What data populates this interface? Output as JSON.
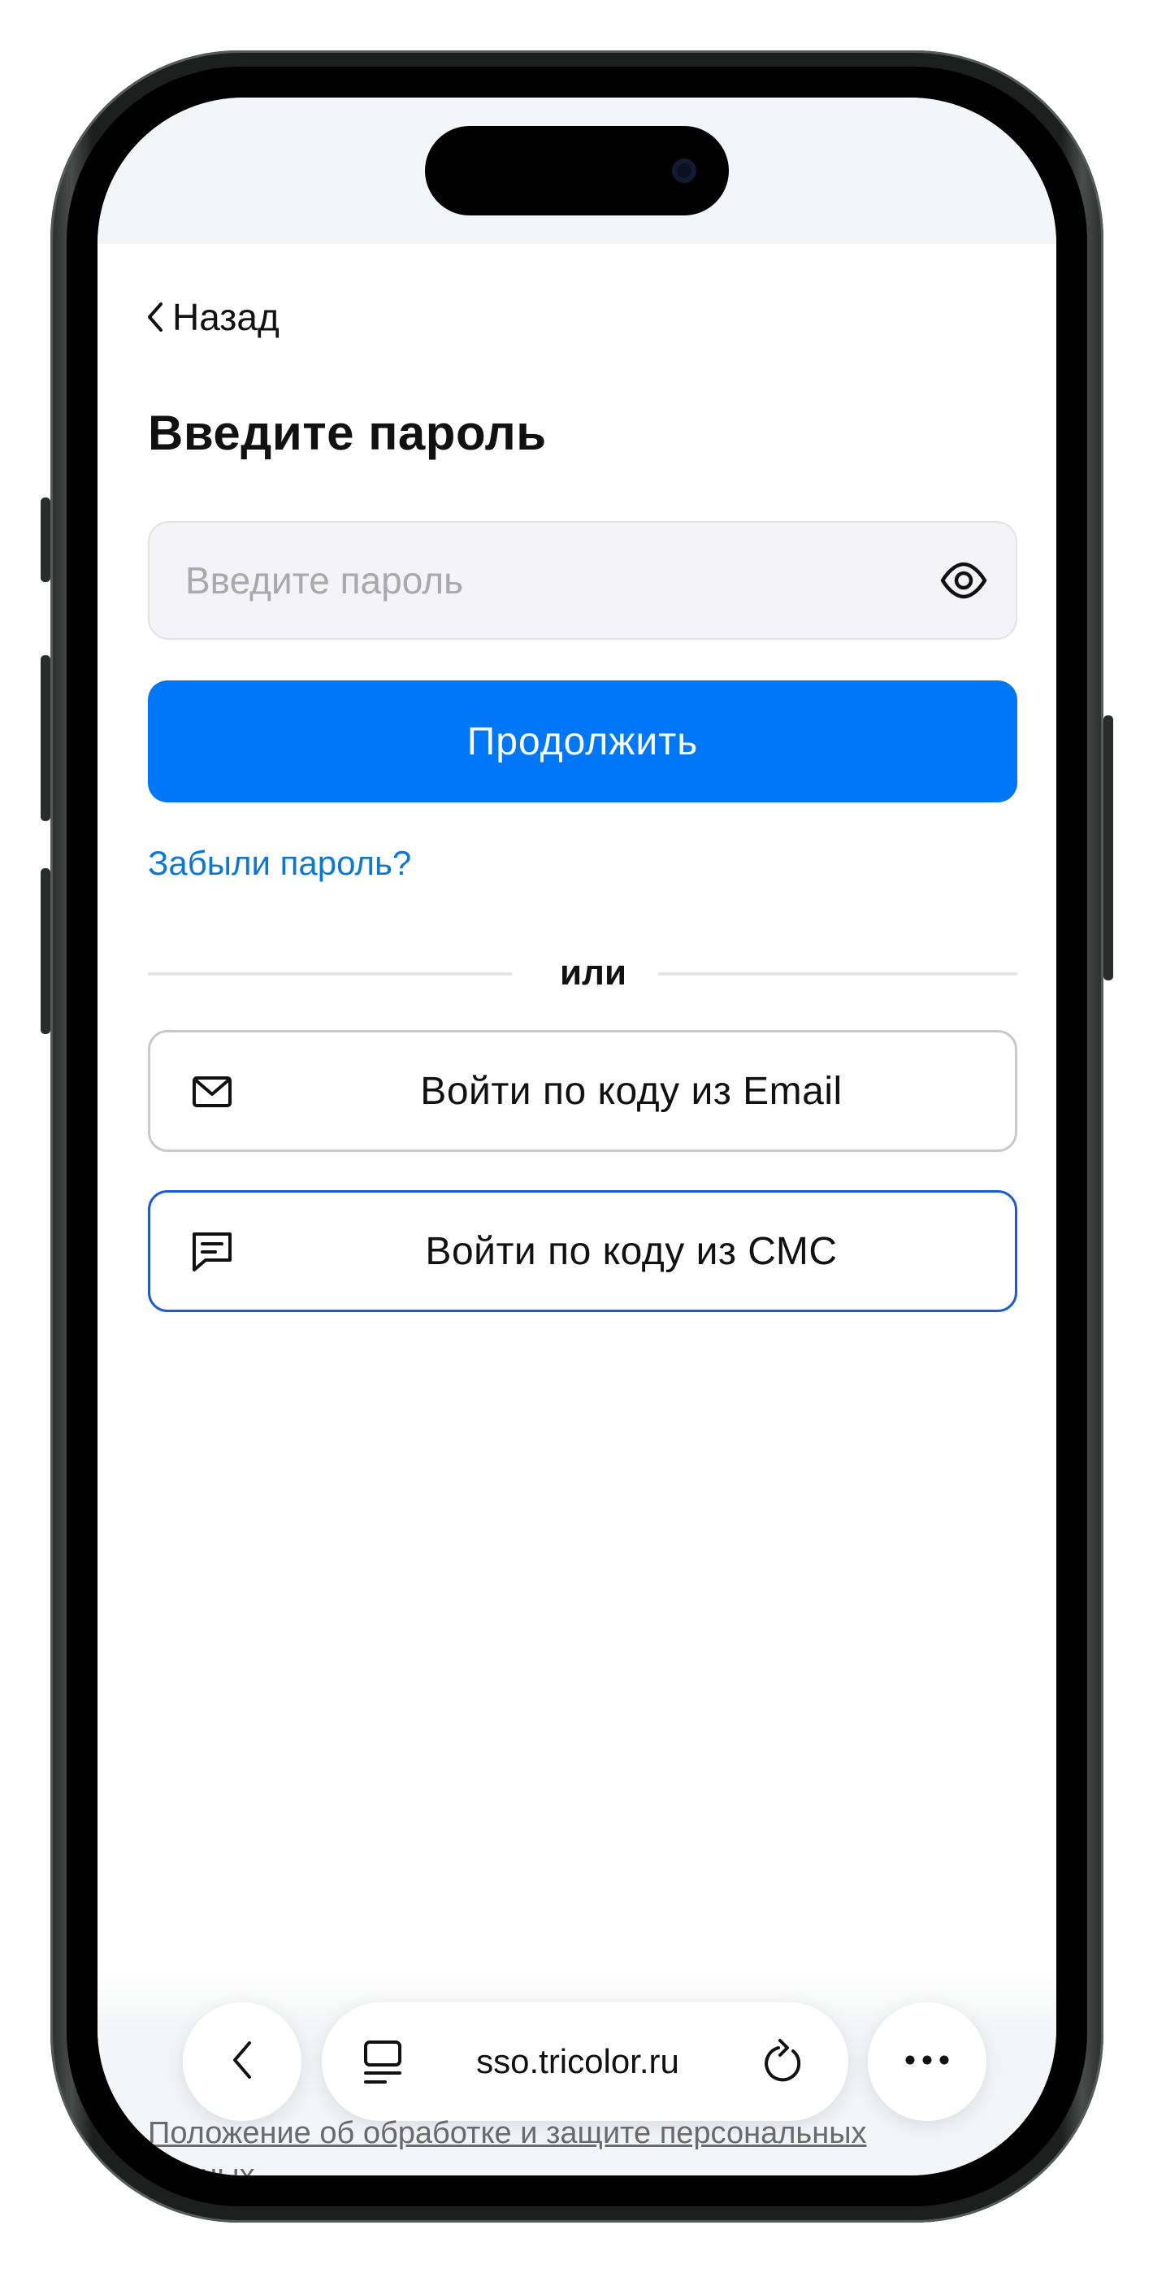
{
  "header": {
    "back_label": "Назад",
    "title": "Введите пароль"
  },
  "password": {
    "placeholder": "Введите пароль",
    "value": "",
    "toggle_icon": "eye-icon"
  },
  "actions": {
    "continue_label": "Продолжить",
    "forgot_label": "Забыли пароль?",
    "divider_label": "или",
    "email_login_label": "Войти по коду из Email",
    "email_icon": "envelope-icon",
    "sms_login_label": "Войти по коду из СМС",
    "sms_icon": "message-icon"
  },
  "browser": {
    "url": "sso.tricolor.ru",
    "back_icon": "chevron-left-icon",
    "tabs_icon": "tabs-icon",
    "reload_icon": "reload-icon",
    "more_icon": "more-dots-icon"
  },
  "footer": {
    "privacy_link": "Положение об обработке и защите персональных данных"
  },
  "colors": {
    "primary": "#0077f7",
    "link": "#0b78d6",
    "sms_border": "#1b5bd6",
    "field_bg": "#f4f4f6"
  }
}
